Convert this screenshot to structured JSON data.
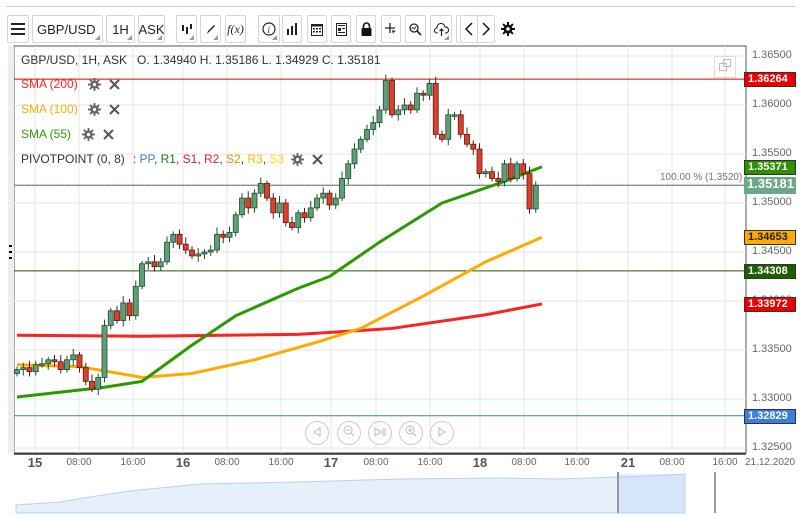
{
  "toolbar": {
    "symbol": "GBP/USD",
    "timeframe": "1H",
    "price_type": "ASK",
    "fx_label": "f(x)"
  },
  "header": {
    "title": "GBP/USD, 1H, ASK",
    "ohlc": "O. 1.34940 H. 1.35186 L. 1.34929 C. 1.35181"
  },
  "indicators": [
    {
      "label": "SMA (200)",
      "color": "#ff2020"
    },
    {
      "label": "SMA (100)",
      "color": "#ffaa00"
    },
    {
      "label": "SMA (55)",
      "color": "#2a9a00"
    }
  ],
  "pivot": {
    "label": "PIVOTPOINT (0, 8)",
    "sep": ": ",
    "items": [
      {
        "t": "PP",
        "c": "#3a7fe0"
      },
      {
        "t": "R1",
        "c": "#1e7a1e"
      },
      {
        "t": "S1",
        "c": "#cc2020"
      },
      {
        "t": "R2",
        "c": "#ee2020"
      },
      {
        "t": "S2",
        "c": "#ff8800"
      },
      {
        "t": "R3",
        "c": "#ffbb00"
      },
      {
        "t": "S3",
        "c": "#ffdd00"
      }
    ]
  },
  "fib_label": "100.00 % (1.3520)",
  "price_axis": [
    "1.36500",
    "1.36000",
    "1.35500",
    "1.35000",
    "1.34500",
    "1.34000",
    "1.33500",
    "1.33000",
    "1.32500"
  ],
  "price_labels": [
    {
      "v": "1.36264",
      "bg": "#ee0000"
    },
    {
      "v": "1.35371",
      "bg": "#2f8f00"
    },
    {
      "v": "1.35181",
      "bg": "#6aa887"
    },
    {
      "v": "1.34653",
      "bg": "#ffaa00"
    },
    {
      "v": "1.34308",
      "bg": "#1f5e00"
    },
    {
      "v": "1.33972",
      "bg": "#ee0000"
    },
    {
      "v": "1.32829",
      "bg": "#3a7fe0"
    }
  ],
  "time_axis": [
    {
      "t": "15",
      "day": true
    },
    {
      "t": "08:00"
    },
    {
      "t": "16:00"
    },
    {
      "t": "16",
      "day": true
    },
    {
      "t": "08:00"
    },
    {
      "t": "16:00"
    },
    {
      "t": "17",
      "day": true
    },
    {
      "t": "08:00"
    },
    {
      "t": "16:00"
    },
    {
      "t": "18",
      "day": true
    },
    {
      "t": "08:00"
    },
    {
      "t": "16:00"
    },
    {
      "t": "21",
      "day": true
    },
    {
      "t": "08:00"
    },
    {
      "t": "16:00"
    },
    {
      "t": "21.12.2020"
    }
  ],
  "chart_data": {
    "type": "candlestick",
    "ylim": [
      1.3235,
      1.3685
    ],
    "closes": [
      1.333,
      1.3332,
      1.3328,
      1.3335,
      1.3336,
      1.334,
      1.3338,
      1.333,
      1.334,
      1.3345,
      1.3332,
      1.3318,
      1.331,
      1.3322,
      1.3375,
      1.339,
      1.338,
      1.3398,
      1.3385,
      1.3415,
      1.3438,
      1.344,
      1.3435,
      1.344,
      1.346,
      1.3468,
      1.3458,
      1.3452,
      1.3446,
      1.3448,
      1.345,
      1.3452,
      1.3468,
      1.3465,
      1.347,
      1.3488,
      1.3505,
      1.3495,
      1.351,
      1.352,
      1.3505,
      1.349,
      1.35,
      1.348,
      1.3475,
      1.349,
      1.3485,
      1.3495,
      1.3505,
      1.351,
      1.3498,
      1.3505,
      1.3525,
      1.354,
      1.3555,
      1.3565,
      1.3575,
      1.3582,
      1.3595,
      1.3625,
      1.359,
      1.3595,
      1.36,
      1.3595,
      1.3612,
      1.361,
      1.3622,
      1.357,
      1.3565,
      1.359,
      1.359,
      1.357,
      1.356,
      1.3555,
      1.353,
      1.3532,
      1.3525,
      1.3522,
      1.354,
      1.3525,
      1.354,
      1.353,
      1.3494,
      1.35181
    ],
    "sma200": [
      [
        0,
        1.3365
      ],
      [
        20,
        1.3364
      ],
      [
        45,
        1.3366
      ],
      [
        60,
        1.3372
      ],
      [
        75,
        1.3386
      ],
      [
        84,
        1.3397
      ]
    ],
    "sma100": [
      [
        0,
        1.3335
      ],
      [
        10,
        1.3333
      ],
      [
        20,
        1.3322
      ],
      [
        28,
        1.3326
      ],
      [
        38,
        1.334
      ],
      [
        48,
        1.3358
      ],
      [
        55,
        1.3372
      ],
      [
        65,
        1.3405
      ],
      [
        75,
        1.344
      ],
      [
        84,
        1.3465
      ]
    ],
    "sma55": [
      [
        0,
        1.3302
      ],
      [
        14,
        1.3312
      ],
      [
        20,
        1.3318
      ],
      [
        28,
        1.3355
      ],
      [
        35,
        1.3385
      ],
      [
        45,
        1.3413
      ],
      [
        50,
        1.3425
      ],
      [
        58,
        1.346
      ],
      [
        68,
        1.35
      ],
      [
        78,
        1.3522
      ],
      [
        84,
        1.3537
      ]
    ],
    "hlines": [
      {
        "v": 1.36264,
        "c": "#dd0000"
      },
      {
        "v": 1.35181,
        "c": "#555555"
      },
      {
        "v": 1.34308,
        "c": "#1f5e00"
      },
      {
        "v": 1.32829,
        "c": "#3a7fe0"
      }
    ]
  }
}
